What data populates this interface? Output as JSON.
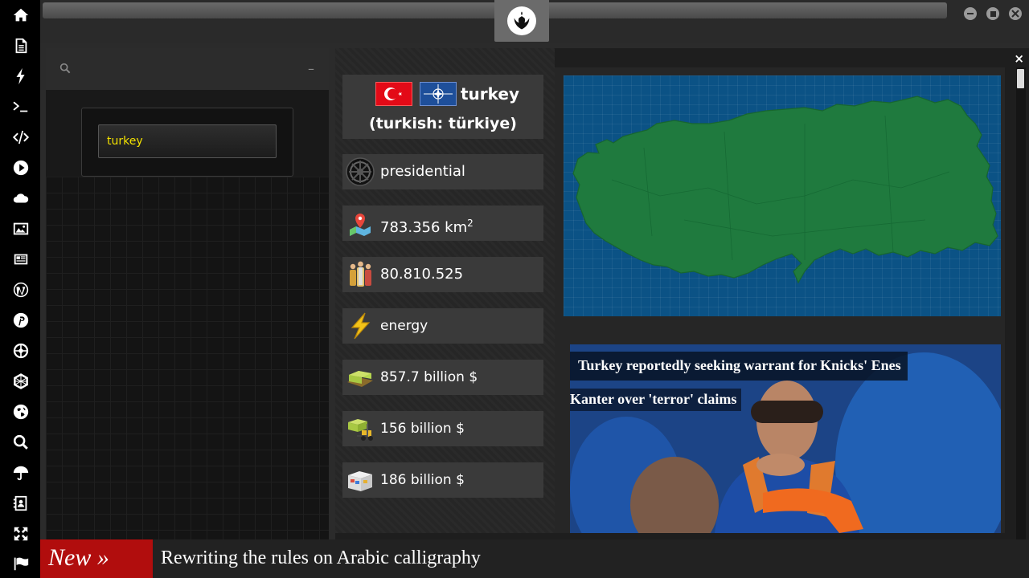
{
  "sidebar": {
    "icons": [
      "home-icon",
      "document-icon",
      "bolt-icon",
      "terminal-icon",
      "code-icon",
      "play-icon",
      "cloud-icon",
      "image-icon",
      "newspaper-icon",
      "wordpress-icon",
      "pinterest-icon",
      "empire-icon",
      "globe-grid-icon",
      "earth-icon",
      "search-icon",
      "umbrella-icon",
      "contact-book-icon",
      "expand-icon",
      "flag-icon"
    ]
  },
  "search": {
    "value": "turkey"
  },
  "left_panel": {
    "collapse_label": "–"
  },
  "main": {
    "close_label": "×",
    "country": {
      "name": "turkey",
      "native_name": "(turkish: türkiye)"
    },
    "stats": {
      "government": "presidential",
      "area": "783.356 km",
      "area_unit_sup": "2",
      "population": "80.810.525",
      "energy": "energy",
      "gdp": "857.7 billion $",
      "imports": "156 billion $",
      "exports": "186 billion $"
    },
    "news": {
      "headline_line1": "Turkey reportedly seeking warrant for Knicks' Enes",
      "headline_line2": "Kanter over 'terror' claims"
    }
  },
  "ticker": {
    "badge": "New »",
    "text": "Rewriting the rules on Arabic calligraphy"
  },
  "colors": {
    "ticker_badge": "#b10d0d",
    "search_text": "#f2e000",
    "map_sea": "#0b5285",
    "map_land": "#1f7a3e"
  }
}
